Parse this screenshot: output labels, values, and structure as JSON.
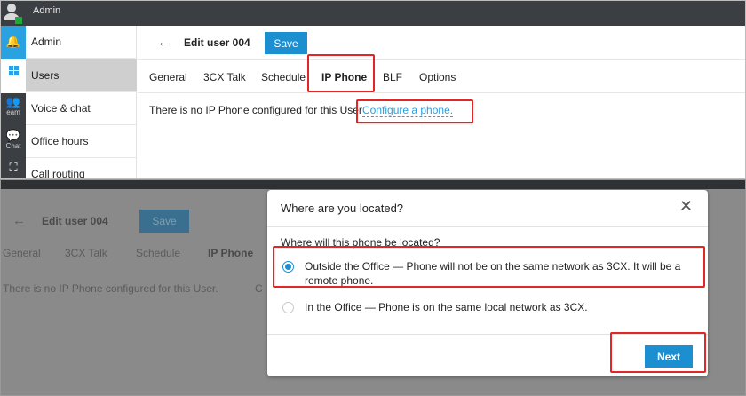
{
  "app": {
    "title": "Admin"
  },
  "rail": [
    {
      "icon": "bell-icon",
      "label": ""
    },
    {
      "icon": "windows-icon",
      "label": ""
    },
    {
      "icon": "team-icon",
      "label": "eam"
    },
    {
      "icon": "chat-icon",
      "label": "Chat"
    },
    {
      "icon": "meet-icon",
      "label": ""
    }
  ],
  "sidebar": {
    "items": [
      {
        "label": "Admin"
      },
      {
        "label": "Users"
      },
      {
        "label": "Voice & chat"
      },
      {
        "label": "Office hours"
      },
      {
        "label": "Call routing"
      }
    ]
  },
  "header": {
    "title": "Edit user  004",
    "save_label": "Save"
  },
  "tabs": [
    {
      "label": "General"
    },
    {
      "label": "3CX Talk"
    },
    {
      "label": "Schedule"
    },
    {
      "label": "IP Phone"
    },
    {
      "label": "BLF"
    },
    {
      "label": "Options"
    }
  ],
  "main": {
    "message": "There is no IP Phone configured for this User",
    "configure_link": "Configure a phone."
  },
  "background": {
    "title": "Edit user  004",
    "save_label": "Save",
    "tabs": [
      "General",
      "3CX Talk",
      "Schedule",
      "IP Phone"
    ],
    "message": "There is no IP Phone configured for this User.",
    "trailing": "C"
  },
  "modal": {
    "title": "Where are you located?",
    "close_glyph": "✕",
    "question": "Where will this phone be located?",
    "options": [
      {
        "label": "Outside the Office — Phone will not be on the same network as 3CX. It will be a remote phone.",
        "checked": true
      },
      {
        "label": "In the Office — Phone is on the same local network as 3CX.",
        "checked": false
      }
    ],
    "next_label": "Next"
  },
  "colors": {
    "accent": "#1c8fd1",
    "highlight": "#e32525",
    "dark": "#3b3f43"
  }
}
